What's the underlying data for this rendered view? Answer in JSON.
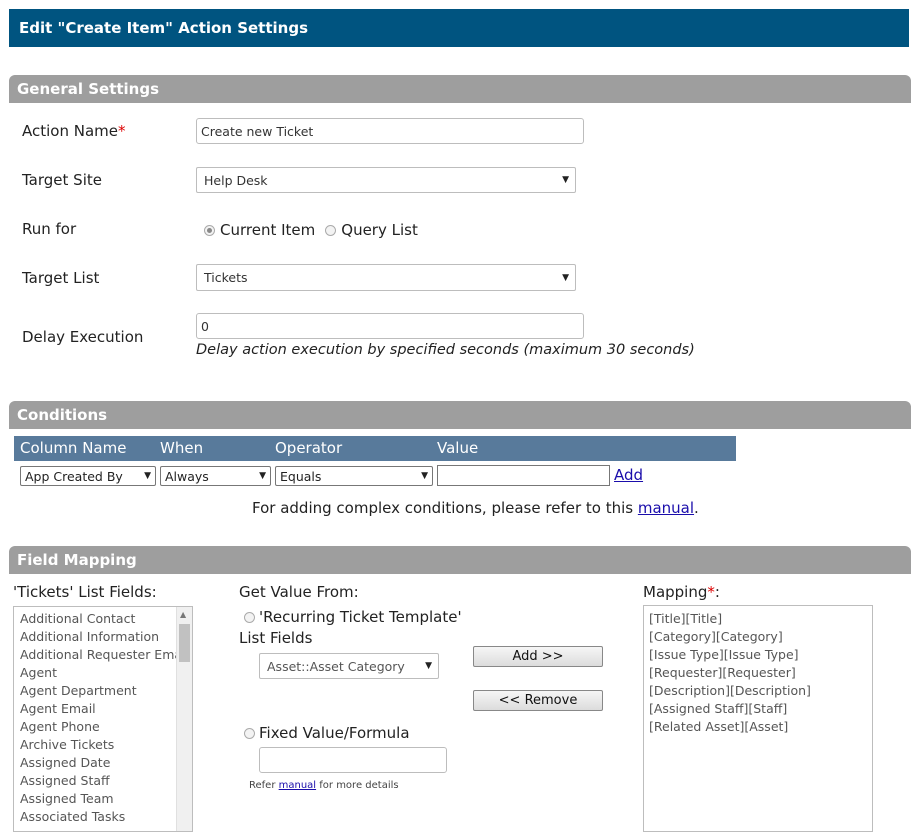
{
  "window_title": "Edit \"Create Item\" Action Settings",
  "general": {
    "header": "General Settings",
    "action_name_label": "Action Name",
    "required_mark": "*",
    "action_name_value": "Create new Ticket",
    "target_site_label": "Target Site",
    "target_site_value": "Help Desk",
    "run_for_label": "Run for",
    "run_for_options": [
      "Current Item",
      "Query List"
    ],
    "run_for_selected": "Current Item",
    "target_list_label": "Target List",
    "target_list_value": "Tickets",
    "delay_label": "Delay Execution",
    "delay_value": "0",
    "delay_hint": "Delay action execution by specified seconds (maximum 30 seconds)"
  },
  "conditions": {
    "header": "Conditions",
    "columns": [
      "Column Name",
      "When",
      "Operator",
      "Value"
    ],
    "column_name_value": "App Created By",
    "when_value": "Always",
    "operator_value": "Equals",
    "value_value": "",
    "add_link": "Add",
    "note_prefix": "For adding complex conditions, please refer to this",
    "note_link": "manual",
    "note_suffix": "."
  },
  "mapping": {
    "header": "Field Mapping",
    "list_fields_label": "'Tickets' List Fields:",
    "list_fields": [
      "Additional Contact",
      "Additional Information",
      "Additional Requester Email",
      "Agent",
      "Agent Department",
      "Agent Email",
      "Agent Phone",
      "Archive Tickets",
      "Assigned Date",
      "Assigned Staff",
      "Assigned Team",
      "Associated Tasks"
    ],
    "get_value_label": "Get Value From:",
    "source_option_1": "'Recurring Ticket Template'",
    "source_option_1b": "List Fields",
    "source_select_value": "Asset::Asset Category",
    "source_option_2": "Fixed Value/Formula",
    "fixed_value": "",
    "refer_prefix": "Refer",
    "refer_link": "manual",
    "refer_suffix": "for more details",
    "add_button": "Add >>",
    "remove_button": "<< Remove",
    "mapping_label": "Mapping",
    "mapping_items": [
      "[Title][Title]",
      "[Category][Category]",
      "[Issue Type][Issue Type]",
      "[Requester][Requester]",
      "[Description][Description]",
      "[Assigned Staff][Staff]",
      "[Related Asset][Asset]"
    ]
  },
  "colors": {
    "title_bar": "#005480",
    "section_header": "#9e9e9e",
    "condition_header": "#587a9b",
    "required": "#dd0000",
    "link": "#1a0dab"
  }
}
